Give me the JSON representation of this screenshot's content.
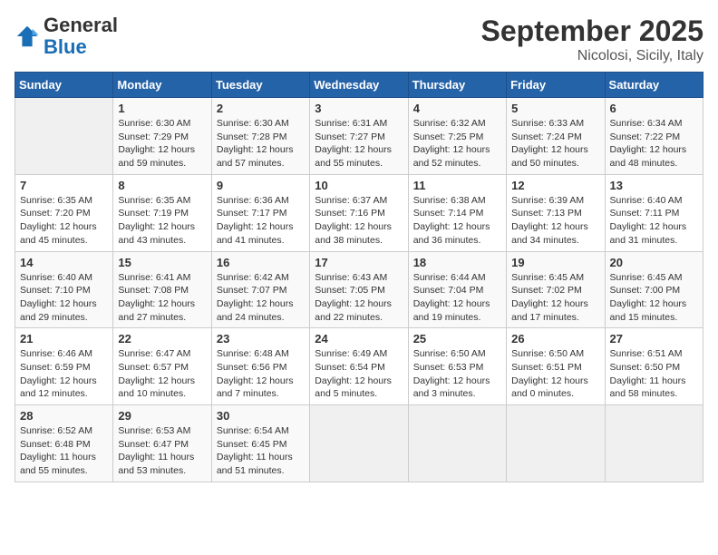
{
  "logo": {
    "general": "General",
    "blue": "Blue"
  },
  "title": "September 2025",
  "subtitle": "Nicolosi, Sicily, Italy",
  "days_of_week": [
    "Sunday",
    "Monday",
    "Tuesday",
    "Wednesday",
    "Thursday",
    "Friday",
    "Saturday"
  ],
  "weeks": [
    [
      {
        "day": "",
        "info": ""
      },
      {
        "day": "1",
        "info": "Sunrise: 6:30 AM\nSunset: 7:29 PM\nDaylight: 12 hours\nand 59 minutes."
      },
      {
        "day": "2",
        "info": "Sunrise: 6:30 AM\nSunset: 7:28 PM\nDaylight: 12 hours\nand 57 minutes."
      },
      {
        "day": "3",
        "info": "Sunrise: 6:31 AM\nSunset: 7:27 PM\nDaylight: 12 hours\nand 55 minutes."
      },
      {
        "day": "4",
        "info": "Sunrise: 6:32 AM\nSunset: 7:25 PM\nDaylight: 12 hours\nand 52 minutes."
      },
      {
        "day": "5",
        "info": "Sunrise: 6:33 AM\nSunset: 7:24 PM\nDaylight: 12 hours\nand 50 minutes."
      },
      {
        "day": "6",
        "info": "Sunrise: 6:34 AM\nSunset: 7:22 PM\nDaylight: 12 hours\nand 48 minutes."
      }
    ],
    [
      {
        "day": "7",
        "info": "Sunrise: 6:35 AM\nSunset: 7:20 PM\nDaylight: 12 hours\nand 45 minutes."
      },
      {
        "day": "8",
        "info": "Sunrise: 6:35 AM\nSunset: 7:19 PM\nDaylight: 12 hours\nand 43 minutes."
      },
      {
        "day": "9",
        "info": "Sunrise: 6:36 AM\nSunset: 7:17 PM\nDaylight: 12 hours\nand 41 minutes."
      },
      {
        "day": "10",
        "info": "Sunrise: 6:37 AM\nSunset: 7:16 PM\nDaylight: 12 hours\nand 38 minutes."
      },
      {
        "day": "11",
        "info": "Sunrise: 6:38 AM\nSunset: 7:14 PM\nDaylight: 12 hours\nand 36 minutes."
      },
      {
        "day": "12",
        "info": "Sunrise: 6:39 AM\nSunset: 7:13 PM\nDaylight: 12 hours\nand 34 minutes."
      },
      {
        "day": "13",
        "info": "Sunrise: 6:40 AM\nSunset: 7:11 PM\nDaylight: 12 hours\nand 31 minutes."
      }
    ],
    [
      {
        "day": "14",
        "info": "Sunrise: 6:40 AM\nSunset: 7:10 PM\nDaylight: 12 hours\nand 29 minutes."
      },
      {
        "day": "15",
        "info": "Sunrise: 6:41 AM\nSunset: 7:08 PM\nDaylight: 12 hours\nand 27 minutes."
      },
      {
        "day": "16",
        "info": "Sunrise: 6:42 AM\nSunset: 7:07 PM\nDaylight: 12 hours\nand 24 minutes."
      },
      {
        "day": "17",
        "info": "Sunrise: 6:43 AM\nSunset: 7:05 PM\nDaylight: 12 hours\nand 22 minutes."
      },
      {
        "day": "18",
        "info": "Sunrise: 6:44 AM\nSunset: 7:04 PM\nDaylight: 12 hours\nand 19 minutes."
      },
      {
        "day": "19",
        "info": "Sunrise: 6:45 AM\nSunset: 7:02 PM\nDaylight: 12 hours\nand 17 minutes."
      },
      {
        "day": "20",
        "info": "Sunrise: 6:45 AM\nSunset: 7:00 PM\nDaylight: 12 hours\nand 15 minutes."
      }
    ],
    [
      {
        "day": "21",
        "info": "Sunrise: 6:46 AM\nSunset: 6:59 PM\nDaylight: 12 hours\nand 12 minutes."
      },
      {
        "day": "22",
        "info": "Sunrise: 6:47 AM\nSunset: 6:57 PM\nDaylight: 12 hours\nand 10 minutes."
      },
      {
        "day": "23",
        "info": "Sunrise: 6:48 AM\nSunset: 6:56 PM\nDaylight: 12 hours\nand 7 minutes."
      },
      {
        "day": "24",
        "info": "Sunrise: 6:49 AM\nSunset: 6:54 PM\nDaylight: 12 hours\nand 5 minutes."
      },
      {
        "day": "25",
        "info": "Sunrise: 6:50 AM\nSunset: 6:53 PM\nDaylight: 12 hours\nand 3 minutes."
      },
      {
        "day": "26",
        "info": "Sunrise: 6:50 AM\nSunset: 6:51 PM\nDaylight: 12 hours\nand 0 minutes."
      },
      {
        "day": "27",
        "info": "Sunrise: 6:51 AM\nSunset: 6:50 PM\nDaylight: 11 hours\nand 58 minutes."
      }
    ],
    [
      {
        "day": "28",
        "info": "Sunrise: 6:52 AM\nSunset: 6:48 PM\nDaylight: 11 hours\nand 55 minutes."
      },
      {
        "day": "29",
        "info": "Sunrise: 6:53 AM\nSunset: 6:47 PM\nDaylight: 11 hours\nand 53 minutes."
      },
      {
        "day": "30",
        "info": "Sunrise: 6:54 AM\nSunset: 6:45 PM\nDaylight: 11 hours\nand 51 minutes."
      },
      {
        "day": "",
        "info": ""
      },
      {
        "day": "",
        "info": ""
      },
      {
        "day": "",
        "info": ""
      },
      {
        "day": "",
        "info": ""
      }
    ]
  ]
}
